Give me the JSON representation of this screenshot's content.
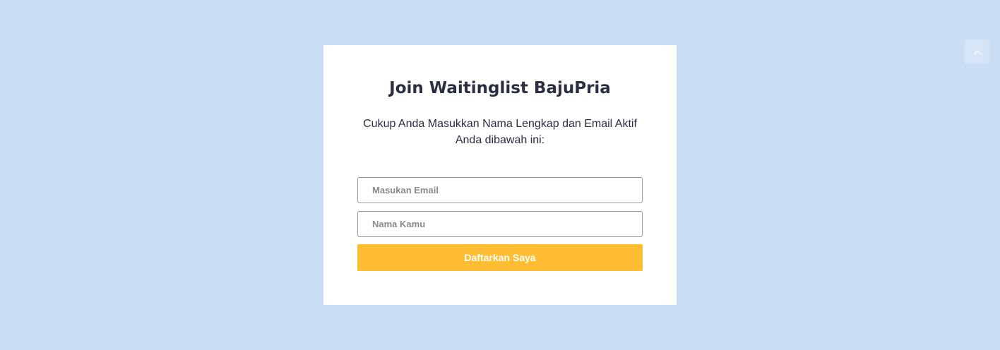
{
  "form": {
    "title": "Join Waitinglist BajuPria",
    "subtitle": "Cukup Anda Masukkan Nama Lengkap dan Email Aktif Anda dibawah ini:",
    "email_placeholder": "Masukan Email",
    "name_placeholder": "Nama Kamu",
    "submit_label": "Daftarkan Saya"
  },
  "scroll_top": {
    "icon": "chevron-up-icon"
  },
  "colors": {
    "background": "#c9ddf4",
    "card": "#ffffff",
    "accent": "#ffbd33",
    "text": "#2b2d42"
  }
}
